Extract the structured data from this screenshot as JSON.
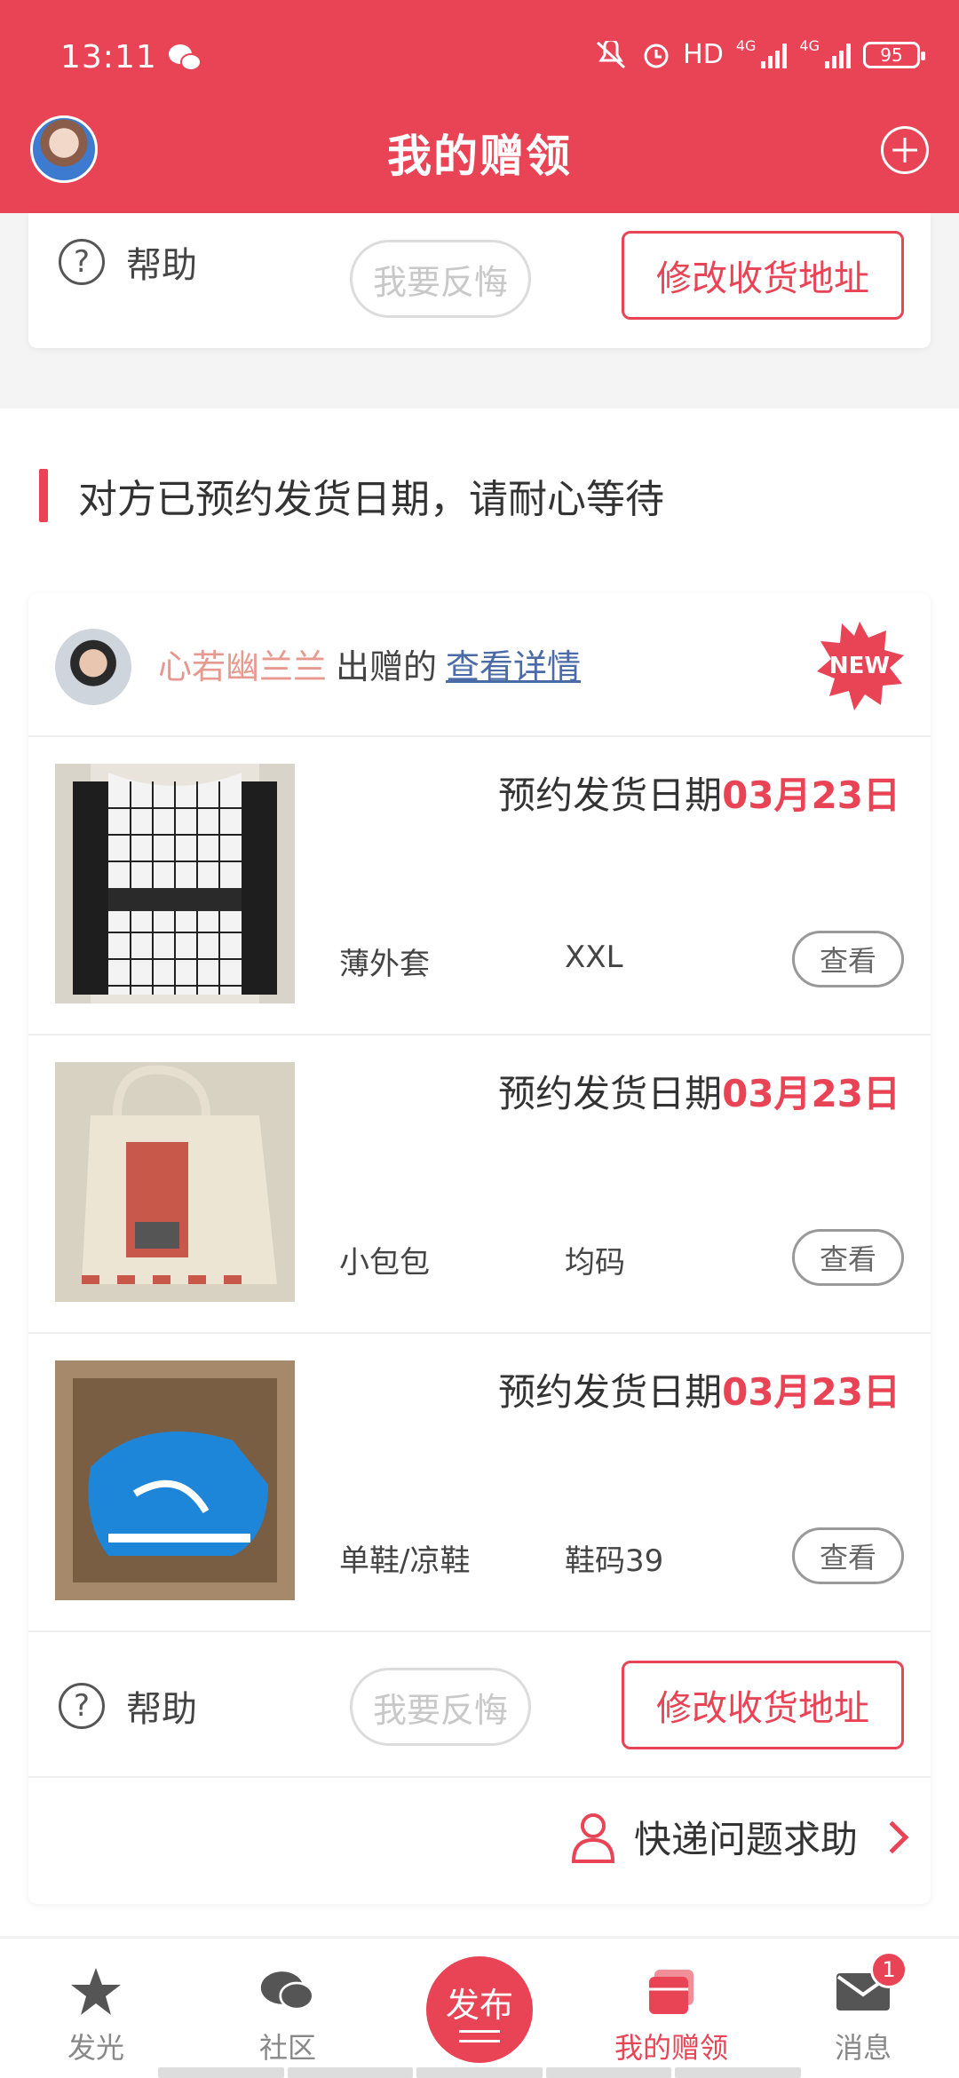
{
  "status_bar": {
    "time": "13:11",
    "hd": "HD",
    "net1": "4G",
    "net2": "4G",
    "battery": "95"
  },
  "header": {
    "title": "我的赠领"
  },
  "top_card": {
    "help": "帮助",
    "regret": "我要反悔",
    "edit_address": "修改收货地址"
  },
  "section": {
    "title": "对方已预约发货日期，请耐心等待"
  },
  "donation": {
    "donor_name": "心若幽兰兰",
    "donor_suffix": "出赠的",
    "details_link": "查看详情",
    "new_badge": "NEW",
    "items": [
      {
        "date_label": "预约发货日期",
        "date": "03月23日",
        "name": "薄外套",
        "size": "XXL",
        "view": "查看"
      },
      {
        "date_label": "预约发货日期",
        "date": "03月23日",
        "name": "小包包",
        "size": "均码",
        "view": "查看"
      },
      {
        "date_label": "预约发货日期",
        "date": "03月23日",
        "name": "单鞋/凉鞋",
        "size": "鞋码39",
        "view": "查看"
      }
    ],
    "help": "帮助",
    "regret": "我要反悔",
    "edit_address": "修改收货地址",
    "express_help": "快递问题求助"
  },
  "tabbar": {
    "tabs": [
      {
        "label": "发光",
        "icon": "star-icon"
      },
      {
        "label": "社区",
        "icon": "chat-bubble-icon"
      },
      {
        "label": "发布",
        "icon": "publish-icon"
      },
      {
        "label": "我的赠领",
        "icon": "gift-cards-icon",
        "active": true
      },
      {
        "label": "消息",
        "icon": "mail-icon",
        "badge": "1"
      }
    ]
  },
  "colors": {
    "brand": "#e84455",
    "donor_name": "#e8998f",
    "link": "#4a6ba6"
  }
}
